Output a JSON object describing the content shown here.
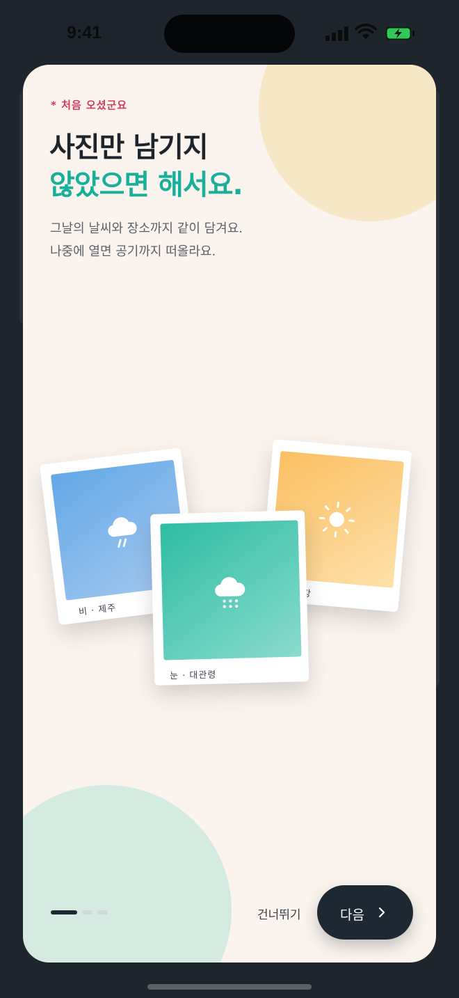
{
  "status_bar": {
    "time": "9:41"
  },
  "onboarding": {
    "eyebrow": "*  처음  오셨군요",
    "title_line1": "사진만 남기지",
    "title_line2": "않았으면 해서요.",
    "description_line1": "그날의 날씨와 장소까지 같이 담겨요.",
    "description_line2": "나중에 열면 공기까지 떠올라요."
  },
  "cards": [
    {
      "caption": "비  ·  제주",
      "icon": "rain-cloud-icon",
      "color": "#63a8e8"
    },
    {
      "caption": "한강",
      "icon": "sun-icon",
      "color": "#fbbf63"
    },
    {
      "caption": "눈  ·  대관령",
      "icon": "snow-cloud-icon",
      "color": "#2dbca5"
    }
  ],
  "pagination": {
    "current": 1,
    "total": 3
  },
  "footer": {
    "skip_label": "건너뛰기",
    "next_label": "다음"
  },
  "colors": {
    "accent": "#18b09a",
    "eyebrow": "#d23a5c",
    "primary_button": "#1e2832",
    "sheet_background": "#fbf4ee"
  }
}
